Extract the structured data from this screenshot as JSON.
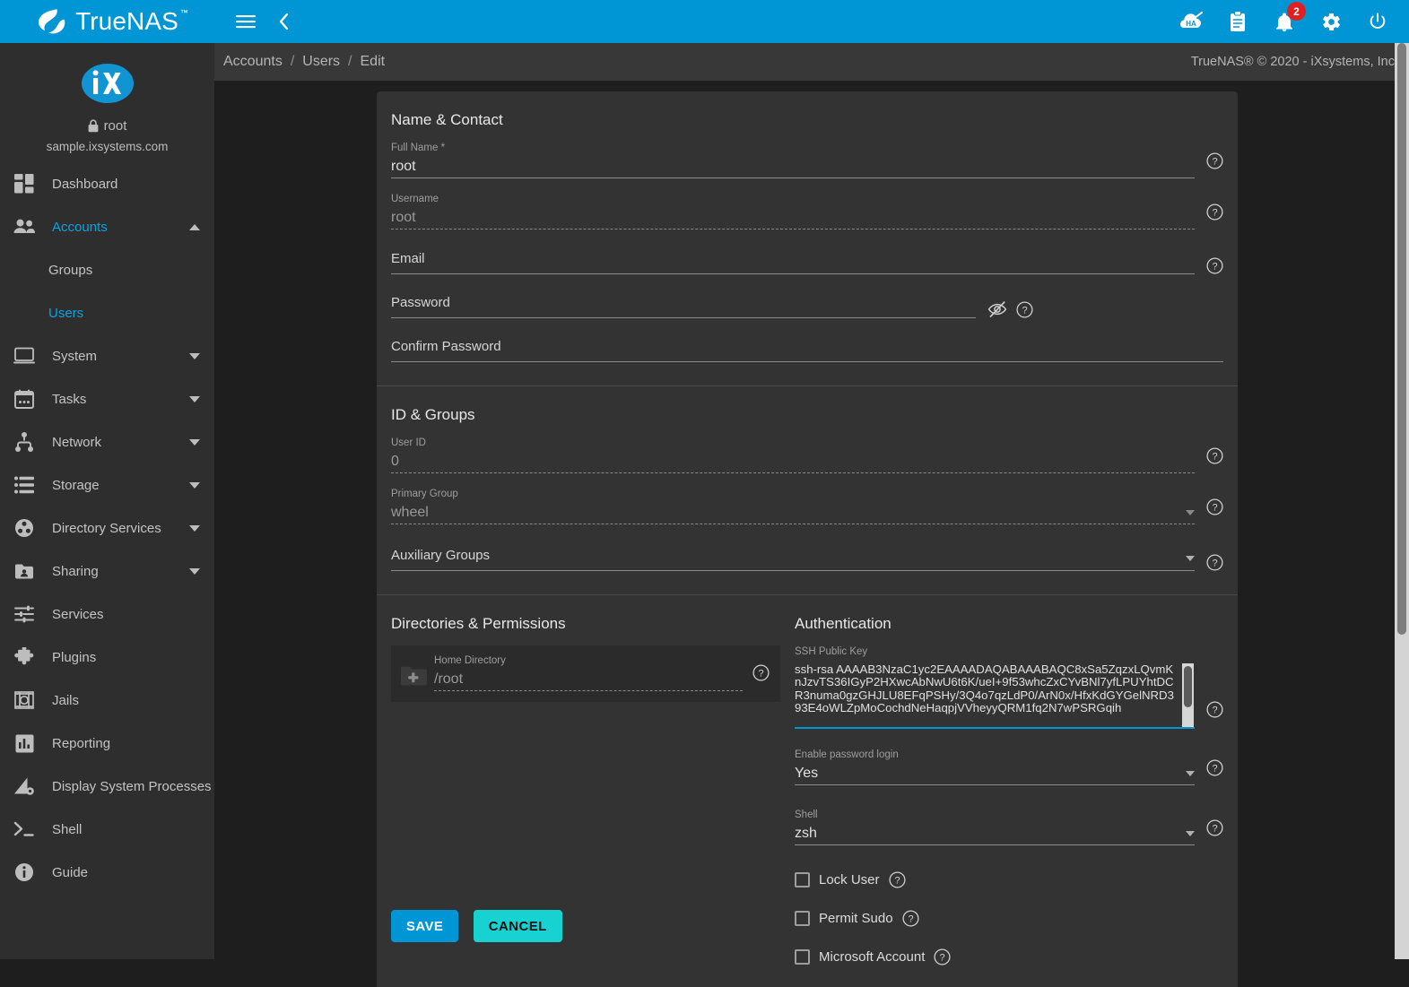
{
  "brand": {
    "name": "TrueNAS",
    "tm": "™"
  },
  "topbar": {
    "menu_icon": "hamburger-menu-icon",
    "back_icon": "chevron-left-icon",
    "ha_icon": "ha-disabled-icon",
    "tasks_icon": "clipboard-icon",
    "alerts_icon": "bell-icon",
    "alerts_count": "2",
    "settings_icon": "gear-icon",
    "power_icon": "power-icon"
  },
  "sidebar": {
    "user": "root",
    "host": "sample.ixsystems.com",
    "lock_icon": "lock-icon",
    "logo_icon": "ix-logo",
    "items": [
      {
        "label": "Dashboard",
        "icon": "dashboard-icon",
        "expandable": false,
        "active": false
      },
      {
        "label": "Accounts",
        "icon": "accounts-icon",
        "expandable": true,
        "expanded": true,
        "active": true
      },
      {
        "label": "System",
        "icon": "system-icon",
        "expandable": true,
        "expanded": false,
        "active": false
      },
      {
        "label": "Tasks",
        "icon": "tasks-icon",
        "expandable": true,
        "expanded": false,
        "active": false
      },
      {
        "label": "Network",
        "icon": "network-icon",
        "expandable": true,
        "expanded": false,
        "active": false
      },
      {
        "label": "Storage",
        "icon": "storage-icon",
        "expandable": true,
        "expanded": false,
        "active": false
      },
      {
        "label": "Directory Services",
        "icon": "directory-services-icon",
        "expandable": true,
        "expanded": false,
        "active": false
      },
      {
        "label": "Sharing",
        "icon": "sharing-icon",
        "expandable": true,
        "expanded": false,
        "active": false
      },
      {
        "label": "Services",
        "icon": "services-icon",
        "expandable": false,
        "active": false
      },
      {
        "label": "Plugins",
        "icon": "plugins-icon",
        "expandable": false,
        "active": false
      },
      {
        "label": "Jails",
        "icon": "jails-icon",
        "expandable": false,
        "active": false
      },
      {
        "label": "Reporting",
        "icon": "reporting-icon",
        "expandable": false,
        "active": false
      },
      {
        "label": "Display System Processes",
        "icon": "display-system-processes-icon",
        "expandable": false,
        "active": false
      },
      {
        "label": "Shell",
        "icon": "shell-icon",
        "expandable": false,
        "active": false
      },
      {
        "label": "Guide",
        "icon": "guide-icon",
        "expandable": false,
        "active": false
      }
    ],
    "sub_groups": "Groups",
    "sub_users": "Users"
  },
  "breadcrumb": {
    "items": [
      "Accounts",
      "Users",
      "Edit"
    ],
    "separator": "/"
  },
  "copyright": "TrueNAS® © 2020 - iXsystems, Inc.",
  "form": {
    "name_contact": {
      "title": "Name & Contact",
      "full_name_label": "Full Name *",
      "full_name_value": "root",
      "username_label": "Username",
      "username_value": "root",
      "email_label": "Email",
      "email_value": "",
      "password_label": "Password",
      "password_value": "",
      "confirm_password_label": "Confirm Password",
      "confirm_password_value": "",
      "toggle_password_icon": "eye-off-icon"
    },
    "id_groups": {
      "title": "ID & Groups",
      "user_id_label": "User ID",
      "user_id_value": "0",
      "primary_group_label": "Primary Group",
      "primary_group_value": "wheel",
      "aux_groups_label": "Auxiliary Groups",
      "aux_groups_value": ""
    },
    "directories": {
      "title": "Directories & Permissions",
      "home_dir_label": "Home Directory",
      "home_dir_value": "/root",
      "folder_icon": "create-folder-icon"
    },
    "authentication": {
      "title": "Authentication",
      "ssh_key_label": "SSH Public Key",
      "ssh_key_line1": "ssh-rsa",
      "ssh_key_value": "ssh-rsa AAAAB3NzaC1yc2EAAAADAQABAAABAQC8xSa5ZqzxLQvmKnJzvTS36IGyP2HXwcAbNwU6t6K/ueI+9f53whcZxCYvBNl7yfLPUYhtDCR3numa0gzGHJLU8EFqPSHy/3Q4o7qzLdP0/ArN0x/HfxKdGYGelNRD393E4oWLZpMoCochdNeHaqpjVVheyyQRM1fq2N7wPSRGqih",
      "enable_password_login_label": "Enable password login",
      "enable_password_login_value": "Yes",
      "shell_label": "Shell",
      "shell_value": "zsh",
      "lock_user_label": "Lock User",
      "lock_user_checked": false,
      "permit_sudo_label": "Permit Sudo",
      "permit_sudo_checked": false,
      "microsoft_account_label": "Microsoft Account",
      "microsoft_account_checked": false
    },
    "actions": {
      "save_label": "SAVE",
      "cancel_label": "CANCEL"
    }
  },
  "colors": {
    "accent_blue": "#0095d5",
    "accent_cyan": "#18d2d2",
    "badge_red": "#e02020",
    "sidebar_bg": "#2e2e2e",
    "card_bg": "#333333",
    "page_bg": "#1e1e1e"
  }
}
